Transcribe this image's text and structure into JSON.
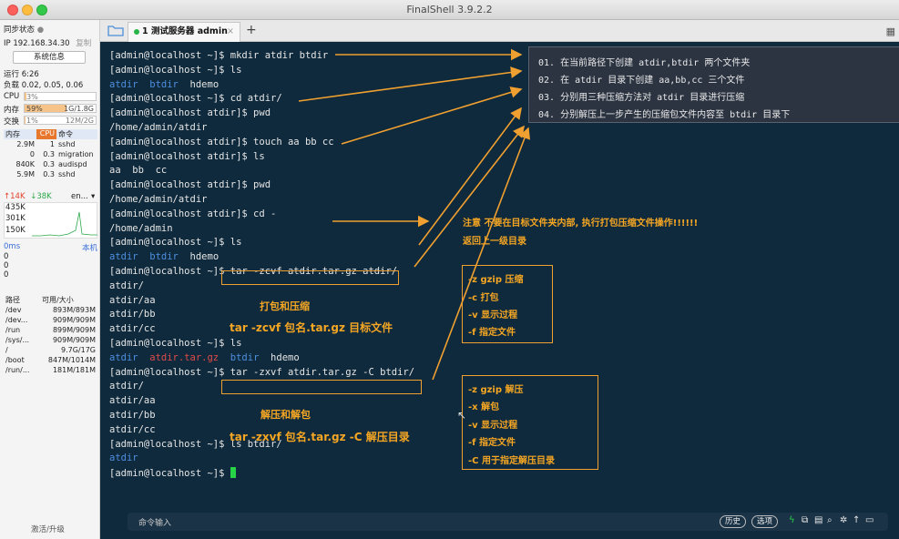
{
  "window": {
    "title": "FinalShell 3.9.2.2"
  },
  "sidebar": {
    "sync_status": "同步状态",
    "ip": "IP 192.168.34.30",
    "copy": "复制",
    "sysinfo_button": "系统信息",
    "uptime": "运行 6:26",
    "load": "负载 0.02, 0.05, 0.06",
    "cpu_label": "CPU",
    "cpu_value": "3%",
    "cpu_fraction": 0.03,
    "mem_label": "内存",
    "mem_percent": "59%",
    "mem_value": "1G/1.8G",
    "mem_fraction": 0.59,
    "swap_label": "交换",
    "swap_percent": "1%",
    "swap_value": "12M/2G",
    "swap_fraction": 0.01,
    "proc_headers": [
      "内存",
      "CPU",
      "命令"
    ],
    "processes": [
      {
        "mem": "2.9M",
        "cpu": "1",
        "cmd": "sshd"
      },
      {
        "mem": "0",
        "cpu": "0.3",
        "cmd": "migration"
      },
      {
        "mem": "840K",
        "cpu": "0.3",
        "cmd": "audispd"
      },
      {
        "mem": "5.9M",
        "cpu": "0.3",
        "cmd": "sshd"
      }
    ],
    "net_up": "↑14K",
    "net_down": "↓38K",
    "net_iface": "en...",
    "net_scale": [
      "435K",
      "301K",
      "150K"
    ],
    "ping_label": "0ms",
    "ping_host": "本机",
    "ping_scale": [
      "0",
      "0",
      "0"
    ],
    "disk_headers": [
      "路径",
      "可用/大小"
    ],
    "disks": [
      {
        "path": "/dev",
        "size": "893M/893M"
      },
      {
        "path": "/dev...",
        "size": "909M/909M"
      },
      {
        "path": "/run",
        "size": "899M/909M"
      },
      {
        "path": "/sys/...",
        "size": "909M/909M"
      },
      {
        "path": "/",
        "size": "9.7G/17G"
      },
      {
        "path": "/boot",
        "size": "847M/1014M"
      },
      {
        "path": "/run/...",
        "size": "181M/181M"
      }
    ],
    "activate": "激活/升级"
  },
  "tabs": {
    "active_tab": "1 测试服务器 admin",
    "close": "×",
    "add": "+"
  },
  "terminal": {
    "lines": [
      {
        "prompt": "[admin@localhost ~]$ ",
        "cmd": "mkdir atdir btdir"
      },
      {
        "prompt": "[admin@localhost ~]$ ",
        "cmd": "ls"
      },
      {
        "ls": [
          "atdir",
          "btdir",
          "hdemo"
        ]
      },
      {
        "prompt": "[admin@localhost ~]$ ",
        "cmd": "cd atdir/"
      },
      {
        "prompt": "[admin@localhost atdir]$ ",
        "cmd": "pwd"
      },
      {
        "text": "/home/admin/atdir"
      },
      {
        "prompt": "[admin@localhost atdir]$ ",
        "cmd": "touch aa bb cc"
      },
      {
        "prompt": "[admin@localhost atdir]$ ",
        "cmd": "ls"
      },
      {
        "text": "aa  bb  cc"
      },
      {
        "prompt": "[admin@localhost atdir]$ ",
        "cmd": "pwd"
      },
      {
        "text": "/home/admin/atdir"
      },
      {
        "prompt": "[admin@localhost atdir]$ ",
        "cmd": "cd -"
      },
      {
        "text": "/home/admin"
      },
      {
        "prompt": "[admin@localhost ~]$ ",
        "cmd": "ls"
      },
      {
        "ls": [
          "atdir",
          "btdir",
          "hdemo"
        ]
      },
      {
        "prompt": "[admin@localhost ~]$ ",
        "cmd": "tar -zcvf atdir.tar.gz atdir/"
      },
      {
        "text": "atdir/"
      },
      {
        "text": "atdir/aa"
      },
      {
        "text": "atdir/bb"
      },
      {
        "text": "atdir/cc"
      },
      {
        "prompt": "[admin@localhost ~]$ ",
        "cmd": "ls"
      },
      {
        "ls": [
          "atdir",
          "atdir.tar.gz",
          "btdir",
          "hdemo"
        ]
      },
      {
        "prompt": "[admin@localhost ~]$ ",
        "cmd": "tar -zxvf atdir.tar.gz -C btdir/"
      },
      {
        "text": "atdir/"
      },
      {
        "text": "atdir/aa"
      },
      {
        "text": "atdir/bb"
      },
      {
        "text": "atdir/cc"
      },
      {
        "prompt": "[admin@localhost ~]$ ",
        "cmd": "ls btdir/"
      },
      {
        "ls": [
          "atdir"
        ]
      },
      {
        "prompt": "[admin@localhost ~]$ ",
        "cmd": ""
      }
    ]
  },
  "notes": [
    "01. 在当前路径下创建 atdir,btdir 两个文件夹",
    "02. 在 atdir 目录下创建 aa,bb,cc 三个文件",
    "03. 分别用三种压缩方法对 atdir 目录进行压缩",
    "04. 分别解压上一步产生的压缩包文件内容至 btdir 目录下"
  ],
  "annotations": {
    "warning_line1": "注意  不要在目标文件夹内部, 执行打包压缩文件操作!!!!!!",
    "warning_line2": "返回上一级目录",
    "compress_title": "打包和压缩",
    "compress_syntax": "tar -zcvf 包名.tar.gz 目标文件",
    "extract_title": "解压和解包",
    "extract_syntax": "tar -zxvf 包名.tar.gz -C 解压目录",
    "compress_options": [
      "-z  gzip 压缩",
      "-c  打包",
      "-v  显示过程",
      "-f  指定文件"
    ],
    "extract_options": [
      "-z  gzip 解压",
      "-x  解包",
      "-v  显示过程",
      "-f  指定文件",
      "-C  用于指定解压目录"
    ]
  },
  "cmdbar": {
    "label": "命令输入",
    "history": "历史",
    "options": "选项"
  },
  "colors": {
    "terminal_bg": "#0f2a3c",
    "dir_blue": "#4e8fe0",
    "archive_red": "#e14a4a",
    "annotation_orange": "#f5a623",
    "cursor_green": "#28d248"
  }
}
